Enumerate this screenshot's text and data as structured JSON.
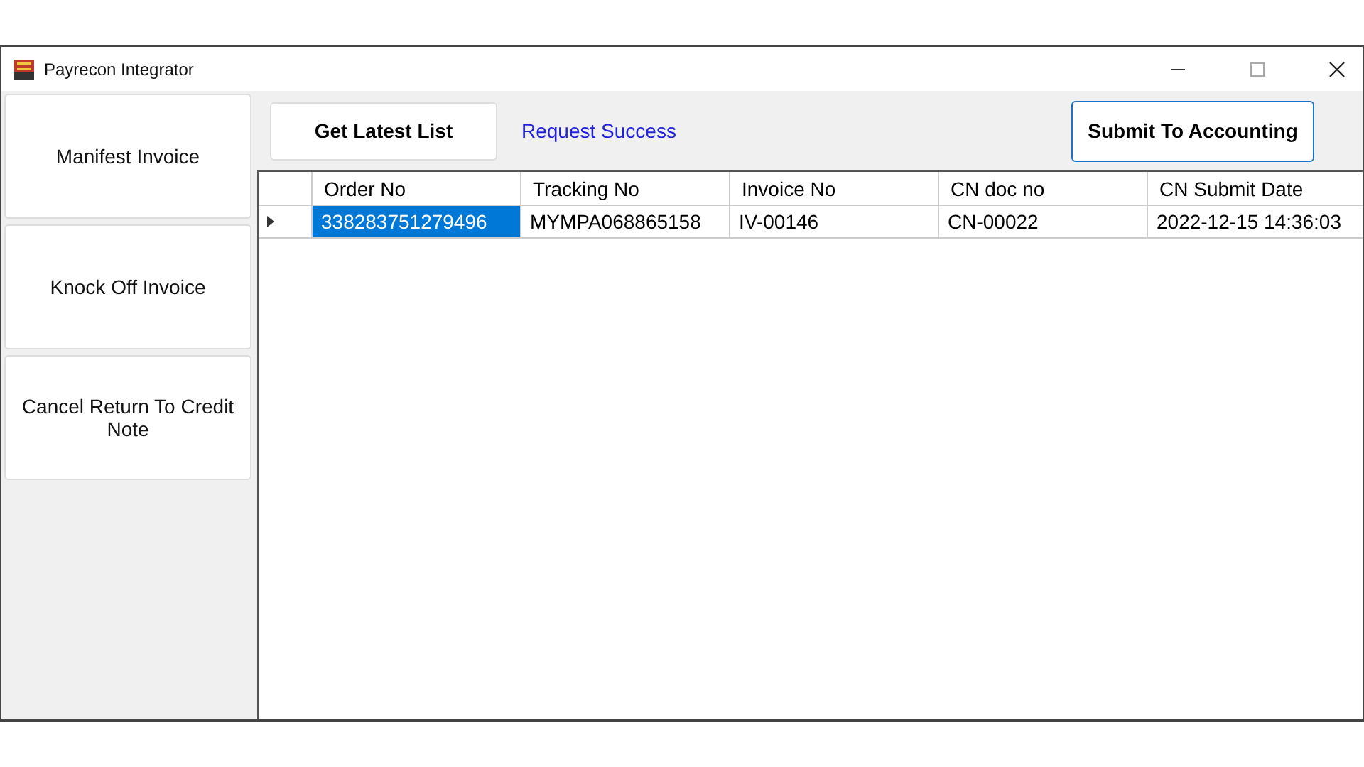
{
  "window": {
    "title": "Payrecon Integrator"
  },
  "sidebar": {
    "items": [
      {
        "label": "Manifest Invoice"
      },
      {
        "label": "Knock Off Invoice"
      },
      {
        "label": "Cancel Return To Credit Note"
      }
    ]
  },
  "toolbar": {
    "get_button": "Get Latest List",
    "status": "Request Success",
    "submit_button": {
      "label": "Submit To Accounting",
      "focused": true
    }
  },
  "table": {
    "columns": [
      "Order No",
      "Tracking No",
      "Invoice No",
      "CN doc no",
      "CN Submit Date"
    ],
    "rows": [
      {
        "current": true,
        "cells": [
          {
            "text": "338283751279496",
            "selected": true
          },
          {
            "text": "MYMPA068865158",
            "selected": false
          },
          {
            "text": "IV-00146",
            "selected": false
          },
          {
            "text": "CN-00022",
            "selected": false
          },
          {
            "text": "2022-12-15 14:36:03",
            "selected": false
          }
        ]
      }
    ]
  }
}
